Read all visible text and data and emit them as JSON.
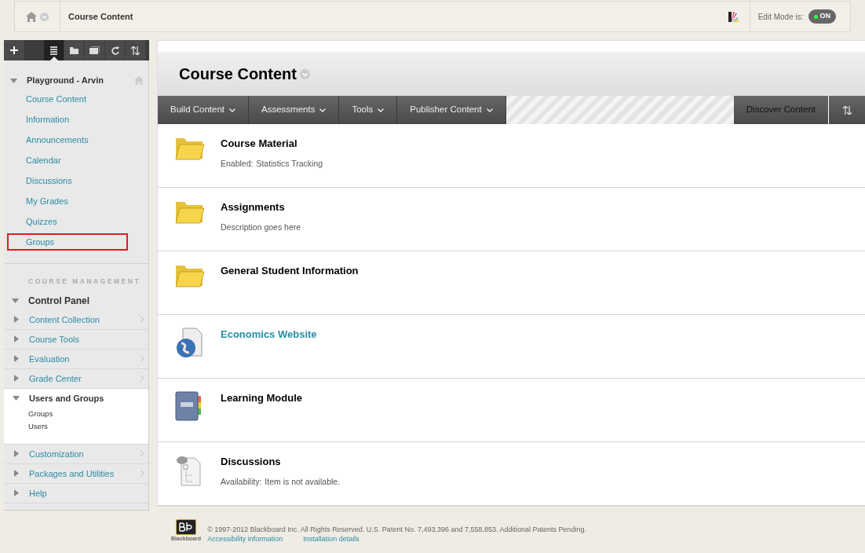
{
  "breadcrumb": {
    "title": "Course Content"
  },
  "edit_mode": {
    "label": "Edit Mode is:",
    "value": "ON",
    "on": true
  },
  "sidebar": {
    "toolbar": [
      {
        "kind": "add",
        "selected": false
      },
      {
        "kind": "list",
        "selected": true
      },
      {
        "kind": "folder",
        "selected": false
      },
      {
        "kind": "window",
        "selected": false
      },
      {
        "kind": "refresh",
        "selected": false
      },
      {
        "kind": "sort",
        "selected": false
      }
    ],
    "course_title": "Playground - Arvin",
    "course_menu": [
      {
        "label": "Course Content",
        "outlined": false
      },
      {
        "label": "Information",
        "outlined": false
      },
      {
        "label": "Announcements",
        "outlined": false
      },
      {
        "label": "Calendar",
        "outlined": false
      },
      {
        "label": "Discussions",
        "outlined": false
      },
      {
        "label": "My Grades",
        "outlined": false
      },
      {
        "label": "Quizzes",
        "outlined": false
      },
      {
        "label": "Groups",
        "outlined": true
      }
    ],
    "management_heading": "COURSE MANAGEMENT",
    "control_panel": "Control Panel",
    "control_items": [
      {
        "label": "Content Collection",
        "expanded": false,
        "chevron": true
      },
      {
        "label": "Course Tools",
        "expanded": false,
        "chevron": false
      },
      {
        "label": "Evaluation",
        "expanded": false,
        "chevron": true
      },
      {
        "label": "Grade Center",
        "expanded": false,
        "chevron": true
      },
      {
        "label": "Users and Groups",
        "expanded": true,
        "chevron": false,
        "children": [
          {
            "label": "Groups"
          },
          {
            "label": "Users"
          }
        ]
      },
      {
        "label": "Customization",
        "expanded": false,
        "chevron": true
      },
      {
        "label": "Packages and Utilities",
        "expanded": false,
        "chevron": true
      },
      {
        "label": "Help",
        "expanded": false,
        "chevron": false
      }
    ]
  },
  "page": {
    "title": "Course Content",
    "action_bar": [
      {
        "label": "Build Content"
      },
      {
        "label": "Assessments"
      },
      {
        "label": "Tools"
      },
      {
        "label": "Publisher Content"
      }
    ],
    "discover": "Discover Content",
    "items": [
      {
        "kind": "folder",
        "title": "Course Material",
        "detail_label": "Enabled:",
        "detail": "Statistics Tracking"
      },
      {
        "kind": "folder",
        "title": "Assignments",
        "detail": "Description goes here"
      },
      {
        "kind": "folder",
        "title": "General Student Information"
      },
      {
        "kind": "link",
        "title": "Economics Website"
      },
      {
        "kind": "module",
        "title": "Learning Module"
      },
      {
        "kind": "discussion",
        "title": "Discussions",
        "detail_label": "Availability:",
        "detail": "Item is not available."
      }
    ]
  },
  "footer": {
    "logo_label": "Blackboard",
    "copyright": "© 1997-2012 Blackboard Inc. All Rights Reserved. U.S. Patent No. 7,493,396 and 7,558,853. Additional Patents Pending.",
    "links": [
      "Accessibility information",
      "Installation details"
    ]
  }
}
